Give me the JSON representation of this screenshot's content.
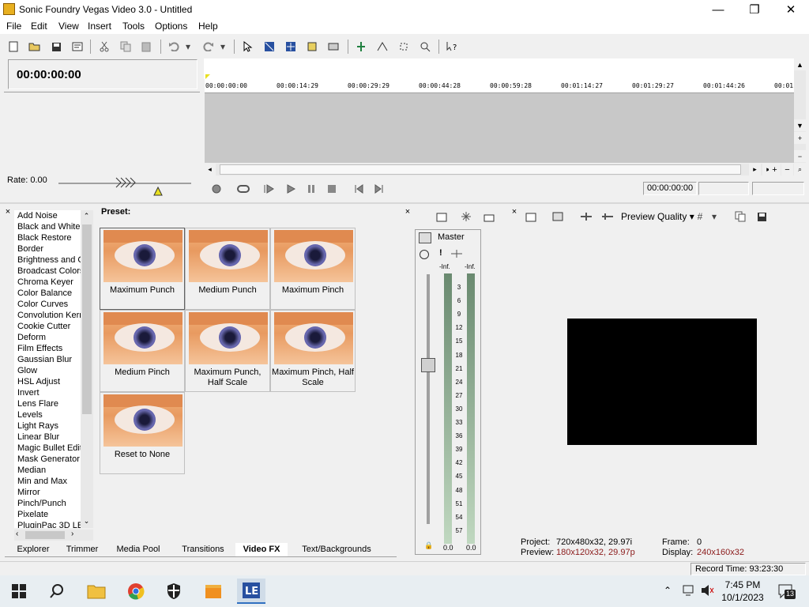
{
  "window": {
    "title": "Sonic Foundry Vegas Video 3.0 - Untitled",
    "minimize": "—",
    "maximize": "❐",
    "close": "✕"
  },
  "menu": [
    "File",
    "Edit",
    "View",
    "Insert",
    "Tools",
    "Options",
    "Help"
  ],
  "timecode": "00:00:00:00",
  "rate_label": "Rate: 0.00",
  "ruler_ticks": [
    "00:00:00:00",
    "00:00:14:29",
    "00:00:29:29",
    "00:00:44:28",
    "00:00:59:28",
    "00:01:14:27",
    "00:01:29:27",
    "00:01:44:26",
    "00:01"
  ],
  "transport_time": "00:00:00:00",
  "fx_list": [
    "Add Noise",
    "Black and White",
    "Black Restore",
    "Border",
    "Brightness and C",
    "Broadcast Colors",
    "Chroma Keyer",
    "Color Balance",
    "Color Curves",
    "Convolution Kern",
    "Cookie Cutter",
    "Deform",
    "Film Effects",
    "Gaussian Blur",
    "Glow",
    "HSL Adjust",
    "Invert",
    "Lens Flare",
    "Levels",
    "Light Rays",
    "Linear Blur",
    "Magic Bullet Edit",
    "Mask Generator",
    "Median",
    "Min and Max",
    "Mirror",
    "Pinch/Punch",
    "Pixelate",
    "PluginPac 3D LE"
  ],
  "preset_label": "Preset:",
  "presets": [
    {
      "label": "Maximum Punch"
    },
    {
      "label": "Medium Punch"
    },
    {
      "label": "Maximum Pinch"
    },
    {
      "label": "Medium Pinch"
    },
    {
      "label": "Maximum Punch, Half Scale"
    },
    {
      "label": "Maximum Pinch, Half Scale"
    },
    {
      "label": "Reset to None"
    }
  ],
  "bottom_tabs": [
    "Explorer",
    "Trimmer",
    "Media Pool",
    "Transitions",
    "Video FX",
    "Text/Backgrounds"
  ],
  "active_tab": "Video FX",
  "mixer": {
    "master_label": "Master",
    "inf_left": "-Inf.",
    "inf_right": "-Inf.",
    "scale": [
      "3",
      "6",
      "9",
      "12",
      "15",
      "18",
      "21",
      "24",
      "27",
      "30",
      "33",
      "36",
      "39",
      "42",
      "45",
      "48",
      "51",
      "54",
      "57"
    ],
    "val_left": "0.0",
    "val_right": "0.0"
  },
  "preview": {
    "quality_label": "Preview Quality",
    "project_label": "Project:",
    "project_value": "720x480x32, 29.97i",
    "preview_label": "Preview:",
    "preview_value": "180x120x32, 29.97p",
    "frame_label": "Frame:",
    "frame_value": "0",
    "display_label": "Display:",
    "display_value": "240x160x32"
  },
  "status": {
    "record_time": "Record Time: 93:23:30"
  },
  "taskbar": {
    "time": "7:45 PM",
    "date": "10/1/2023",
    "notifications": "13"
  },
  "colors": {
    "accent_red": "#8b1a1a",
    "taskbar_bg": "#e8eef2"
  }
}
